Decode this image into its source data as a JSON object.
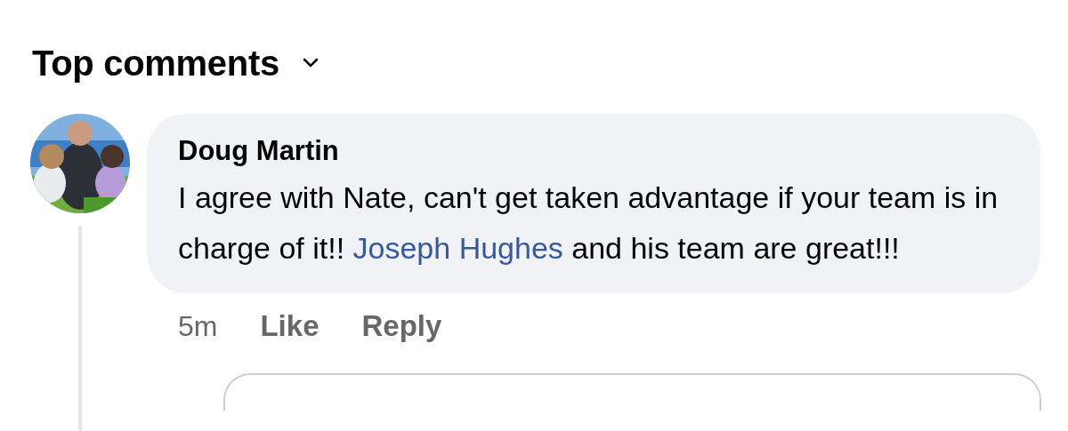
{
  "header": {
    "title": "Top comments"
  },
  "comment": {
    "author": "Doug Martin",
    "text_before": "I agree with Nate, can't get taken advantage if your team is in charge of it!! ",
    "mention": "Joseph Hughes",
    "text_after": " and his team are great!!!",
    "time": "5m",
    "actions": [
      {
        "label": "Like"
      },
      {
        "label": "Reply"
      }
    ]
  }
}
